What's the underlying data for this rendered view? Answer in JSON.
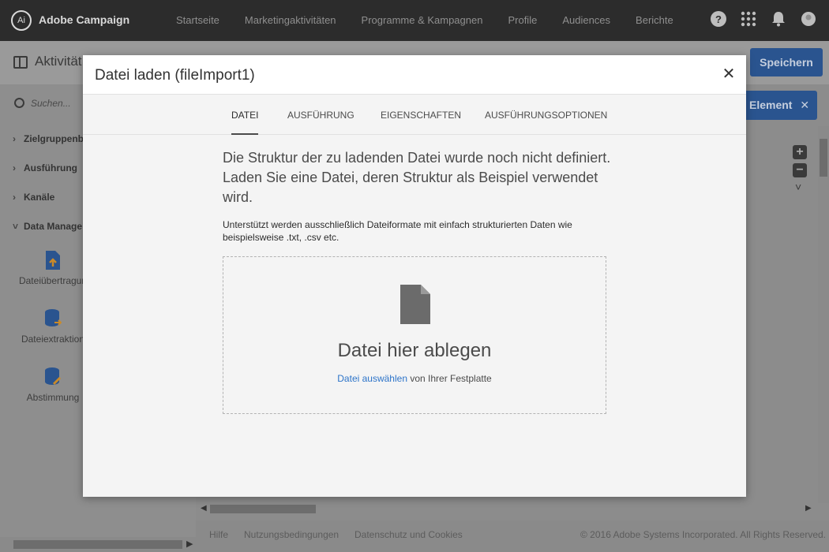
{
  "app": {
    "brand": "Adobe Campaign",
    "logo_glyph": "Ai",
    "nav": [
      "Startseite",
      "Marketingaktivitäten",
      "Programme & Kampagnen",
      "Profile",
      "Audiences",
      "Berichte"
    ],
    "icons": {
      "help": "?",
      "apps": "∷",
      "bell": "♪",
      "user": "●"
    }
  },
  "subbar": {
    "title": "Aktivität",
    "save_label": "Speichern"
  },
  "sidebar": {
    "search_placeholder": "Suchen...",
    "groups": [
      {
        "label": "Zielgruppenb",
        "expanded": false
      },
      {
        "label": "Ausführung",
        "expanded": false
      },
      {
        "label": "Kanäle",
        "expanded": false
      },
      {
        "label": "Data Manage",
        "expanded": true
      }
    ],
    "chevron_right": "›",
    "chevron_down": "˅",
    "tools": [
      {
        "label": "Dateiübertragun",
        "icon": "file-transfer-icon"
      },
      {
        "label": "Dateiextraktion",
        "icon": "file-extraction-icon"
      },
      {
        "label": "Abstimmung",
        "icon": "reconciliation-icon"
      }
    ]
  },
  "canvas": {
    "element_button_label": "Element",
    "element_close_glyph": "✕",
    "zoom_in": "+",
    "zoom_out": "−",
    "chevron": "˅"
  },
  "footer": {
    "links": [
      "Hilfe",
      "Nutzungsbedingungen",
      "Datenschutz und Cookies"
    ],
    "copyright": "© 2016 Adobe Systems Incorporated. All Rights Reserved."
  },
  "modal": {
    "title": "Datei laden (fileImport1)",
    "close_glyph": "✕",
    "tabs": [
      {
        "label": "DATEI",
        "active": true
      },
      {
        "label": "AUSFÜHRUNG",
        "active": false
      },
      {
        "label": "EIGENSCHAFTEN",
        "active": false
      },
      {
        "label": "AUSFÜHRUNGSOPTIONEN",
        "active": false
      }
    ],
    "intro": "Die Struktur der zu ladenden Datei wurde noch nicht definiert. Laden Sie eine Datei, deren Struktur als Beispiel verwendet wird.",
    "note": "Unterstützt werden ausschließlich Dateiformate mit einfach strukturierten Daten wie beispielsweise .txt, .csv etc.",
    "dropzone": {
      "title": "Datei hier ablegen",
      "link_text": "Datei auswählen",
      "suffix": " von Ihrer Festplatte",
      "icon": "file-icon"
    }
  },
  "colors": {
    "primary_button": "#2a548f",
    "link": "#2d74c9",
    "topbar": "#2c2c2c"
  }
}
